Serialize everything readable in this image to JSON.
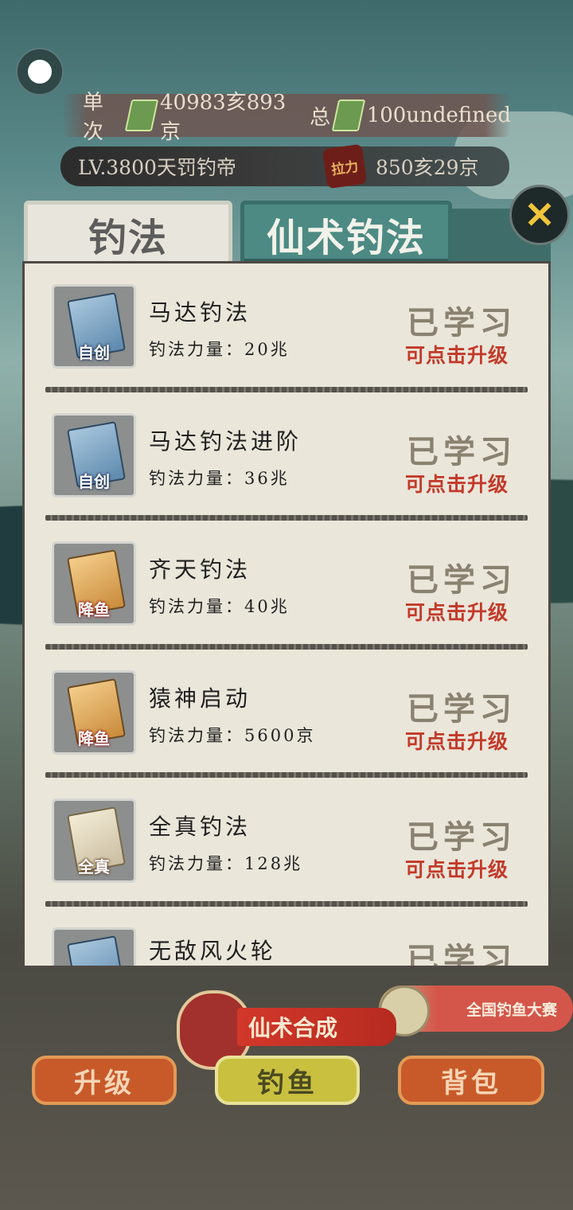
{
  "header": {
    "single_label": "单次",
    "single_value": "40983亥893京",
    "total_label": "总",
    "total_value": "100undefined",
    "level_text": "LV.3800天罚钓帝",
    "pull_badge": "拉力",
    "pull_value": "850亥29京"
  },
  "tabs": [
    {
      "label": "钓法",
      "active": false
    },
    {
      "label": "仙术钓法",
      "active": true
    }
  ],
  "close_symbol": "✕",
  "techniques": [
    {
      "name": "马达钓法",
      "power": "钓法力量：20兆",
      "icon": "blue-book-icon",
      "tag": "自创",
      "status": "已学习",
      "action": "可点击升级"
    },
    {
      "name": "马达钓法进阶",
      "power": "钓法力量：36兆",
      "icon": "blue-book-icon",
      "tag": "自创",
      "status": "已学习",
      "action": "可点击升级"
    },
    {
      "name": "齐天钓法",
      "power": "钓法力量：40兆",
      "icon": "orange-book-icon",
      "tag": "降鱼",
      "status": "已学习",
      "action": "可点击升级"
    },
    {
      "name": "猿神启动",
      "power": "钓法力量：5600京",
      "icon": "orange-book-icon",
      "tag": "降鱼",
      "status": "已学习",
      "action": "可点击升级"
    },
    {
      "name": "全真钓法",
      "power": "钓法力量：128兆",
      "icon": "scroll-icon",
      "tag": "全真",
      "status": "已学习",
      "action": "可点击升级"
    },
    {
      "name": "无敌风火轮",
      "icon": "blue-book-icon",
      "status": "已学习"
    }
  ],
  "bottom": {
    "compose_label": "仙术合成",
    "contest_label": "全国钓鱼大赛",
    "buttons": [
      "升级",
      "钓鱼",
      "背包"
    ]
  },
  "colors": {
    "accent_red": "#c23a2a",
    "tab_active": "#4d8a84",
    "panel": "#eae6da"
  }
}
